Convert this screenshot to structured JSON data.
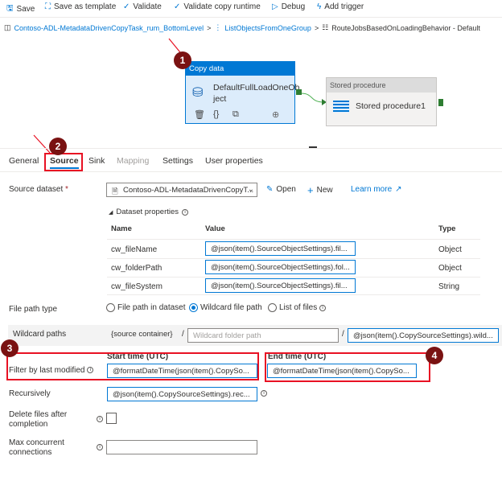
{
  "toolbar": {
    "save": "Save",
    "save_template": "Save as template",
    "validate": "Validate",
    "validate_runtime": "Validate copy runtime",
    "debug": "Debug",
    "add_trigger": "Add trigger"
  },
  "breadcrumb": [
    "Contoso-ADL-MetadataDrivenCopyTask_rum_BottomLevel",
    "ListObjectsFromOneGroup",
    "RouteJobsBasedOnLoadingBehavior - Default"
  ],
  "canvas": {
    "copy": {
      "header": "Copy data",
      "name1": "DefaultFullLoadOneOb",
      "name2": "ject"
    },
    "sp": {
      "header": "Stored procedure",
      "name": "Stored procedure1"
    }
  },
  "badges": [
    "1",
    "2",
    "3",
    "4"
  ],
  "tabs": [
    "General",
    "Source",
    "Sink",
    "Mapping",
    "Settings",
    "User properties"
  ],
  "source": {
    "dataset_label": "Source dataset",
    "required": "*",
    "dataset_value": "Contoso-ADL-MetadataDrivenCopyT...",
    "open": "Open",
    "new": "New",
    "learn_more": "Learn more",
    "props_label": "Dataset properties",
    "cols": [
      "Name",
      "Value",
      "Type"
    ],
    "rows": [
      {
        "name": "cw_fileName",
        "value": "@json(item().SourceObjectSettings).fil...",
        "type": "Object"
      },
      {
        "name": "cw_folderPath",
        "value": "@json(item().SourceObjectSettings).fol...",
        "type": "Object"
      },
      {
        "name": "cw_fileSystem",
        "value": "@json(item().SourceObjectSettings).fil...",
        "type": "String"
      }
    ],
    "file_path_type": "File path type",
    "radio": [
      "File path in dataset",
      "Wildcard file path",
      "List of files"
    ],
    "radio_selected": "Wildcard file path",
    "wildcard_label": "Wildcard paths",
    "container": "{source container}",
    "slash": "/",
    "folder_placeholder": "Wildcard folder path",
    "wildcard_file": "@json(item().CopySourceSettings).wild...",
    "filter_label": "Filter by last modified",
    "start_label": "Start time (UTC)",
    "start_value": "@formatDateTime(json(item().CopySo...",
    "end_label": "End time (UTC)",
    "end_value": "@formatDateTime(json(item().CopySo...",
    "recursively": "Recursively",
    "recursively_value": "@json(item().CopySourceSettings).rec...",
    "delete1": "Delete files after",
    "delete2": "completion",
    "delete_checked": false,
    "max1": "Max concurrent",
    "max2": "connections",
    "max_value": ""
  },
  "colors": {
    "accent": "#0078d4",
    "annotation": "#e81123",
    "badge": "#7a1212",
    "success": "#2e7d32"
  }
}
